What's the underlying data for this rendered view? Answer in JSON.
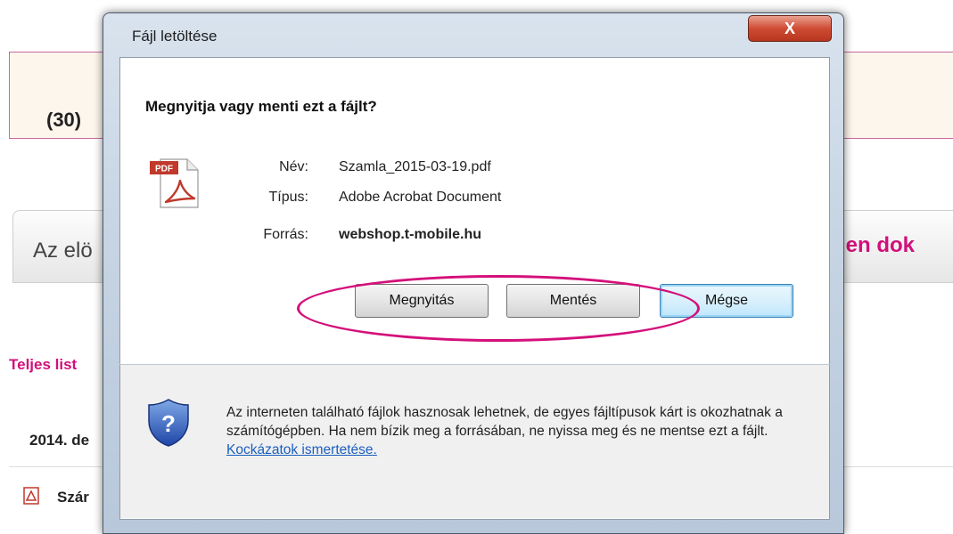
{
  "background": {
    "count": "(30)",
    "tab_left": "Az elö",
    "tab_right": "den dok",
    "link": "Teljes list",
    "date": "2014. de",
    "item": "Szár"
  },
  "dialog": {
    "title": "Fájl letöltése",
    "close_label": "X",
    "question": "Megnyitja vagy menti ezt a fájlt?",
    "fields": {
      "name_label": "Név:",
      "name_value": "Szamla_2015-03-19.pdf",
      "type_label": "Típus:",
      "type_value": "Adobe Acrobat Document",
      "source_label": "Forrás:",
      "source_value": "webshop.t-mobile.hu"
    },
    "buttons": {
      "open": "Megnyitás",
      "save": "Mentés",
      "cancel": "Mégse"
    },
    "warning": {
      "text": "Az interneten található fájlok hasznosak lehetnek, de egyes fájltípusok kárt is okozhatnak a számítógépben. Ha nem bízik meg a forrásában, ne nyissa meg és ne mentse ezt a fájlt. ",
      "link": "Kockázatok ismertetése."
    },
    "pdf_badge": "PDF"
  },
  "icons": {
    "file": "pdf-file-icon",
    "shield": "security-shield-icon",
    "close": "close-icon"
  },
  "colors": {
    "accent": "#d4107a",
    "close_button": "#cf4c34",
    "link": "#1a5fbf"
  }
}
